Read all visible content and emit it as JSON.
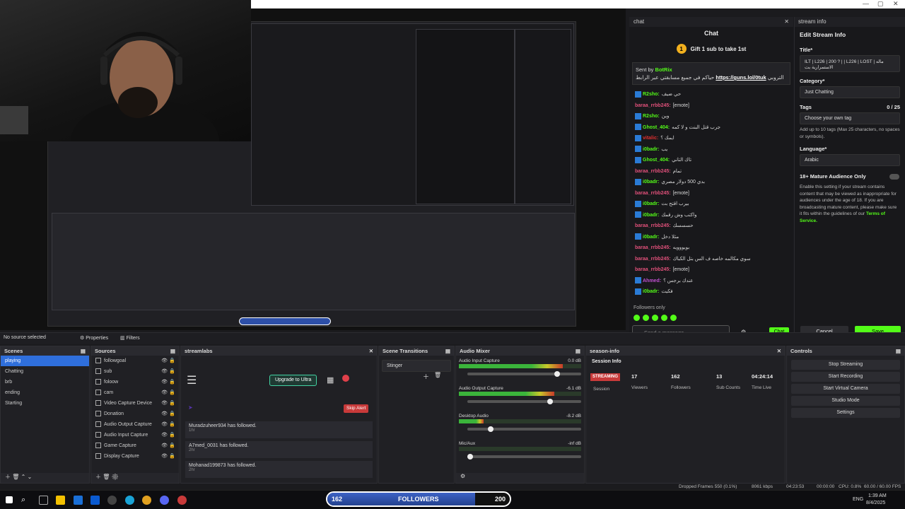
{
  "webcam": {
    "description_icon": "person-icon"
  },
  "preview": {
    "followers_min": "162",
    "followers_label": "FOLLOWERS",
    "followers_max": "200"
  },
  "chat": {
    "header": "chat",
    "title": "Chat",
    "gift_text": "Gift 1 sub to take 1st",
    "pinned_sender": "Sent by",
    "pinned_bot": "BotRix",
    "pinned_text": "حياكم في جميع مسابقتي عبر الرابط",
    "pinned_link": "https://guns.lol/0tuk",
    "pinned_tail": "التروبي",
    "messages": [
      {
        "user": "R2sho:",
        "text": "حي ضيف",
        "color": "#53fc18",
        "badge": true
      },
      {
        "user": "baraa_rrbb245:",
        "text": "[emote]",
        "color": "#e0507a",
        "badge": false
      },
      {
        "user": "R2sho:",
        "text": "وين",
        "color": "#53fc18",
        "badge": true
      },
      {
        "user": "Ghost_404:",
        "text": "جرب قتل البنت و لا كمه",
        "color": "#53fc18",
        "badge": true
      },
      {
        "user": "vitalic:",
        "text": "ايمك ؟",
        "color": "#e03030",
        "badge": true
      },
      {
        "user": "i0badr:",
        "text": "يب",
        "color": "#53fc18",
        "badge": true
      },
      {
        "user": "Ghost_404:",
        "text": "تاك التاني",
        "color": "#53fc18",
        "badge": true
      },
      {
        "user": "baraa_rrbb245:",
        "text": "تمام",
        "color": "#e0507a",
        "badge": false
      },
      {
        "user": "i0badr:",
        "text": "بدي 500 دولار مصري",
        "color": "#53fc18",
        "badge": true
      },
      {
        "user": "baraa_rrbb245:",
        "text": "[emote]",
        "color": "#e0507a",
        "badge": false
      },
      {
        "user": "i0badr:",
        "text": "بيرب اقتح بت",
        "color": "#53fc18",
        "badge": true
      },
      {
        "user": "i0badr:",
        "text": "واكتب وش رقمك",
        "color": "#53fc18",
        "badge": true
      },
      {
        "user": "baraa_rrbb245:",
        "text": "حسسسك",
        "color": "#e0507a",
        "badge": false
      },
      {
        "user": "i0badr:",
        "text": "مثلا دخل",
        "color": "#53fc18",
        "badge": true
      },
      {
        "user": "baraa_rrbb245:",
        "text": "بويووويه",
        "color": "#e0507a",
        "badge": false
      },
      {
        "user": "baraa_rrbb245:",
        "text": "سوي مكالمه خاصه ف الس بتل الكباك",
        "color": "#e0507a",
        "badge": false
      },
      {
        "user": "baraa_rrbb245:",
        "text": "[emote]",
        "color": "#e0507a",
        "badge": false
      },
      {
        "user": "Ahmed:",
        "text": "عندك برجس ؟",
        "color": "#c050d0",
        "badge": true
      },
      {
        "user": "i0badr:",
        "text": "فكيت",
        "color": "#53fc18",
        "badge": true
      }
    ],
    "followers_only": "Followers only",
    "input_placeholder": "Send a message",
    "send_label": "Chat"
  },
  "stream_info": {
    "header": "stream info",
    "title": "Edit Stream Info",
    "title_label": "Title*",
    "title_value": "ILT | L226 | 200 ? | | L226 | LOST | ماله الاستمرارية بت",
    "category_label": "Category*",
    "category_value": "Just Chatting",
    "tags_label": "Tags",
    "tags_count": "0 / 25",
    "tags_placeholder": "Choose your own tag",
    "tags_note": "Add up to 10 tags (Max 25 characters, no spaces or symbols).",
    "language_label": "Language*",
    "language_value": "Arabic",
    "mature_label": "18+ Mature Audience Only",
    "mature_note": "Enable this setting if your stream contains content that may be viewed as inappropriate for audiences under the age of 18. If you are broadcasting mature content, please make sure it fits within the guidelines of our",
    "terms_link": "Terms of Service.",
    "cancel": "Cancel",
    "save": "Save"
  },
  "status": {
    "source": "No source selected",
    "properties": "Properties",
    "filters": "Filters"
  },
  "scenes": {
    "title": "Scenes",
    "items": [
      "playing",
      "Chatting",
      "brb",
      "ending",
      "Starting"
    ]
  },
  "sources": {
    "title": "Sources",
    "items": [
      "followgoal",
      "sub",
      "foloow",
      "cam",
      "Video Capture Device",
      "Donation",
      "Audio Output Capture",
      "Audio Input Capture",
      "Game Capture",
      "Display Capture"
    ]
  },
  "streamlabs": {
    "title": "streamlabs",
    "upgrade": "Upgrade to Ultra",
    "skip": "Skip Alert",
    "events": [
      {
        "text": "Muradzuheer934 has followed.",
        "time": "1hr"
      },
      {
        "text": "A7med_0031 has followed.",
        "time": "2hr"
      },
      {
        "text": "Mohanad199873 has followed.",
        "time": "2hr"
      }
    ]
  },
  "transitions": {
    "title": "Scene Transitions",
    "value": "Stinger"
  },
  "mixer": {
    "title": "Audio Mixer",
    "tracks": [
      {
        "name": "Audio Input Capture",
        "db": "0.0 dB",
        "level": 0.85
      },
      {
        "name": "Audio Output Capture",
        "db": "-6.1 dB",
        "level": 0.78
      },
      {
        "name": "Desktop Audio",
        "db": "-8.2 dB",
        "level": 0.2
      },
      {
        "name": "Mic/Aux",
        "db": "-inf dB",
        "level": 0.0
      }
    ]
  },
  "session": {
    "title": "season-info",
    "subtitle": "Session Info",
    "badge": "STREAMING",
    "session_label": "Session",
    "stats": [
      {
        "value": "17",
        "label": "Viewers"
      },
      {
        "value": "162",
        "label": "Followers"
      },
      {
        "value": "13",
        "label": "Sub Counts"
      },
      {
        "value": "04:24:14",
        "label": "Time Live"
      }
    ]
  },
  "controls": {
    "title": "Controls",
    "buttons": [
      "Stop Streaming",
      "Start Recording",
      "Start Virtual Camera",
      "Studio Mode",
      "Settings"
    ]
  },
  "footer": {
    "dropped": "Dropped Frames 550 (0.1%)",
    "kbps": "8061 kbps",
    "time": "04:23:53",
    "rec": "00:00:00",
    "cpu": "CPU: 0.8%",
    "fps": "60.00 / 60.00 FPS"
  },
  "taskbar": {
    "lang": "ENG",
    "time": "1:39 AM",
    "date": "8/4/2025"
  },
  "followers_goal": {
    "current": "162",
    "label": "FOLLOWERS",
    "goal": "200",
    "progress": 0.81
  }
}
